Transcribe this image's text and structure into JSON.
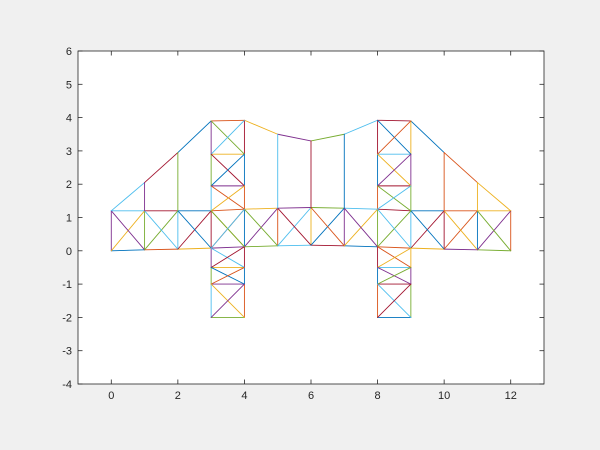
{
  "chart_data": {
    "type": "line",
    "title": "",
    "xlabel": "",
    "ylabel": "",
    "xlim": [
      -1,
      13
    ],
    "ylim": [
      -4,
      6
    ],
    "xticks": [
      "0",
      "2",
      "4",
      "6",
      "8",
      "10",
      "12"
    ],
    "yticks": [
      "-4",
      "-3",
      "-2",
      "-1",
      "0",
      "1",
      "2",
      "3",
      "4",
      "5",
      "6"
    ],
    "grid": false,
    "legend": "none",
    "color_order": [
      "#0072BD",
      "#D95319",
      "#EDB120",
      "#7E2F8E",
      "#77AC30",
      "#4DBEEE",
      "#A2142F"
    ],
    "nodes": {
      "b0": [
        0,
        0
      ],
      "b1": [
        1,
        0.03
      ],
      "b2": [
        2,
        0.05
      ],
      "b3": [
        3,
        0.08
      ],
      "b4": [
        4,
        0.12
      ],
      "b5": [
        5,
        0.15
      ],
      "b6": [
        6,
        0.17
      ],
      "b7": [
        7,
        0.15
      ],
      "b8": [
        8,
        0.12
      ],
      "b9": [
        9,
        0.08
      ],
      "b10": [
        10,
        0.05
      ],
      "b11": [
        11,
        0.03
      ],
      "b12": [
        12,
        0
      ],
      "t0": [
        0,
        1.2
      ],
      "t1": [
        1,
        1.2
      ],
      "t2": [
        2,
        1.2
      ],
      "t3": [
        3,
        1.2
      ],
      "t4": [
        4,
        1.25
      ],
      "t5": [
        5,
        1.28
      ],
      "t6": [
        6,
        1.3
      ],
      "t7": [
        7,
        1.28
      ],
      "t8": [
        8,
        1.25
      ],
      "t9": [
        9,
        1.2
      ],
      "t10": [
        10,
        1.2
      ],
      "t11": [
        11,
        1.2
      ],
      "t12": [
        12,
        1.2
      ],
      "u1": [
        1,
        2.05
      ],
      "u2": [
        2,
        2.95
      ],
      "u3": [
        3,
        3.9
      ],
      "u4": [
        4,
        3.92
      ],
      "u5": [
        5,
        3.5
      ],
      "u6": [
        6,
        3.3
      ],
      "u7": [
        7,
        3.5
      ],
      "u8": [
        8,
        3.92
      ],
      "u9": [
        9,
        3.9
      ],
      "u10": [
        10,
        2.95
      ],
      "u11": [
        11,
        2.05
      ],
      "L3a": [
        3,
        2.9
      ],
      "L4a": [
        4,
        2.9
      ],
      "L3b": [
        3,
        1.95
      ],
      "L4b": [
        4,
        1.95
      ],
      "L3m": [
        3,
        -0.5
      ],
      "L4m": [
        4,
        -0.5
      ],
      "L3c": [
        3,
        -1
      ],
      "L4c": [
        4,
        -1
      ],
      "L3d": [
        3,
        -2
      ],
      "L4d": [
        4,
        -2
      ],
      "R8a": [
        8,
        2.9
      ],
      "R9a": [
        9,
        2.9
      ],
      "R8b": [
        8,
        1.95
      ],
      "R9b": [
        9,
        1.95
      ],
      "R8m": [
        8,
        -0.5
      ],
      "R9m": [
        9,
        -0.5
      ],
      "R8c": [
        8,
        -1
      ],
      "R9c": [
        9,
        -1
      ],
      "R8d": [
        8,
        -2
      ],
      "R9d": [
        9,
        -2
      ]
    },
    "members": [
      [
        "b0",
        "b1"
      ],
      [
        "b1",
        "b2"
      ],
      [
        "b2",
        "b3"
      ],
      [
        "b3",
        "b4"
      ],
      [
        "b4",
        "b5"
      ],
      [
        "b5",
        "b6"
      ],
      [
        "b6",
        "b7"
      ],
      [
        "b7",
        "b8"
      ],
      [
        "b8",
        "b9"
      ],
      [
        "b9",
        "b10"
      ],
      [
        "b10",
        "b11"
      ],
      [
        "b11",
        "b12"
      ],
      [
        "t0",
        "t1"
      ],
      [
        "t1",
        "t2"
      ],
      [
        "t2",
        "t3"
      ],
      [
        "t3",
        "t4"
      ],
      [
        "t4",
        "t5"
      ],
      [
        "t5",
        "t6"
      ],
      [
        "t6",
        "t7"
      ],
      [
        "t7",
        "t8"
      ],
      [
        "t8",
        "t9"
      ],
      [
        "t9",
        "t10"
      ],
      [
        "t10",
        "t11"
      ],
      [
        "t11",
        "t12"
      ],
      [
        "b0",
        "t0"
      ],
      [
        "b1",
        "t1"
      ],
      [
        "b2",
        "t2"
      ],
      [
        "b3",
        "t3"
      ],
      [
        "b4",
        "t4"
      ],
      [
        "b5",
        "t5"
      ],
      [
        "b6",
        "t6"
      ],
      [
        "b7",
        "t7"
      ],
      [
        "b8",
        "t8"
      ],
      [
        "b9",
        "t9"
      ],
      [
        "b10",
        "t10"
      ],
      [
        "b11",
        "t11"
      ],
      [
        "b12",
        "t12"
      ],
      [
        "b0",
        "t1"
      ],
      [
        "t0",
        "b1"
      ],
      [
        "b1",
        "t2"
      ],
      [
        "t1",
        "b2"
      ],
      [
        "b2",
        "t3"
      ],
      [
        "t2",
        "b3"
      ],
      [
        "b3",
        "t4"
      ],
      [
        "t3",
        "b4"
      ],
      [
        "b4",
        "t5"
      ],
      [
        "t4",
        "b5"
      ],
      [
        "b5",
        "t6"
      ],
      [
        "t5",
        "b6"
      ],
      [
        "b6",
        "t7"
      ],
      [
        "t6",
        "b7"
      ],
      [
        "b7",
        "t8"
      ],
      [
        "t7",
        "b8"
      ],
      [
        "b8",
        "t9"
      ],
      [
        "t8",
        "b9"
      ],
      [
        "b9",
        "t10"
      ],
      [
        "t9",
        "b10"
      ],
      [
        "b10",
        "t11"
      ],
      [
        "t10",
        "b11"
      ],
      [
        "b11",
        "t12"
      ],
      [
        "t11",
        "b12"
      ],
      [
        "t0",
        "u1"
      ],
      [
        "u1",
        "u2"
      ],
      [
        "u2",
        "u3"
      ],
      [
        "u3",
        "u4"
      ],
      [
        "u4",
        "u5"
      ],
      [
        "u5",
        "u6"
      ],
      [
        "u6",
        "u7"
      ],
      [
        "u7",
        "u8"
      ],
      [
        "u8",
        "u9"
      ],
      [
        "u9",
        "u10"
      ],
      [
        "u10",
        "u11"
      ],
      [
        "u11",
        "t12"
      ],
      [
        "t1",
        "u1"
      ],
      [
        "t2",
        "u2"
      ],
      [
        "t5",
        "u5"
      ],
      [
        "t6",
        "u6"
      ],
      [
        "t7",
        "u7"
      ],
      [
        "t10",
        "u10"
      ],
      [
        "t11",
        "u11"
      ],
      [
        "u3",
        "L3a"
      ],
      [
        "L3a",
        "L3b"
      ],
      [
        "L3b",
        "t3"
      ],
      [
        "u4",
        "L4a"
      ],
      [
        "L4a",
        "L4b"
      ],
      [
        "L4b",
        "t4"
      ],
      [
        "L3a",
        "L4a"
      ],
      [
        "L3b",
        "L4b"
      ],
      [
        "u3",
        "L4a"
      ],
      [
        "u4",
        "L3a"
      ],
      [
        "L3a",
        "L4b"
      ],
      [
        "L4a",
        "L3b"
      ],
      [
        "L3b",
        "t4"
      ],
      [
        "L4b",
        "t3"
      ],
      [
        "b3",
        "L3m"
      ],
      [
        "L3m",
        "L3c"
      ],
      [
        "L3c",
        "L3d"
      ],
      [
        "b4",
        "L4m"
      ],
      [
        "L4m",
        "L4c"
      ],
      [
        "L4c",
        "L4d"
      ],
      [
        "L3m",
        "L4m"
      ],
      [
        "L3c",
        "L4c"
      ],
      [
        "L3d",
        "L4d"
      ],
      [
        "b3",
        "L4m"
      ],
      [
        "b4",
        "L3m"
      ],
      [
        "L3m",
        "L4c"
      ],
      [
        "L4m",
        "L3c"
      ],
      [
        "L3c",
        "L4d"
      ],
      [
        "L4c",
        "L3d"
      ],
      [
        "t3",
        "b4"
      ],
      [
        "t4",
        "b3"
      ],
      [
        "u8",
        "R8a"
      ],
      [
        "R8a",
        "R8b"
      ],
      [
        "R8b",
        "t8"
      ],
      [
        "u9",
        "R9a"
      ],
      [
        "R9a",
        "R9b"
      ],
      [
        "R9b",
        "t9"
      ],
      [
        "R8a",
        "R9a"
      ],
      [
        "R8b",
        "R9b"
      ],
      [
        "u8",
        "R9a"
      ],
      [
        "u9",
        "R8a"
      ],
      [
        "R8a",
        "R9b"
      ],
      [
        "R9a",
        "R8b"
      ],
      [
        "R8b",
        "t9"
      ],
      [
        "R9b",
        "t8"
      ],
      [
        "b8",
        "R8m"
      ],
      [
        "R8m",
        "R8c"
      ],
      [
        "R8c",
        "R8d"
      ],
      [
        "b9",
        "R9m"
      ],
      [
        "R9m",
        "R9c"
      ],
      [
        "R9c",
        "R9d"
      ],
      [
        "R8m",
        "R9m"
      ],
      [
        "R8c",
        "R9c"
      ],
      [
        "R8d",
        "R9d"
      ],
      [
        "b8",
        "R9m"
      ],
      [
        "b9",
        "R8m"
      ],
      [
        "R8m",
        "R9c"
      ],
      [
        "R9m",
        "R8c"
      ],
      [
        "R8c",
        "R9d"
      ],
      [
        "R9c",
        "R8d"
      ]
    ]
  }
}
